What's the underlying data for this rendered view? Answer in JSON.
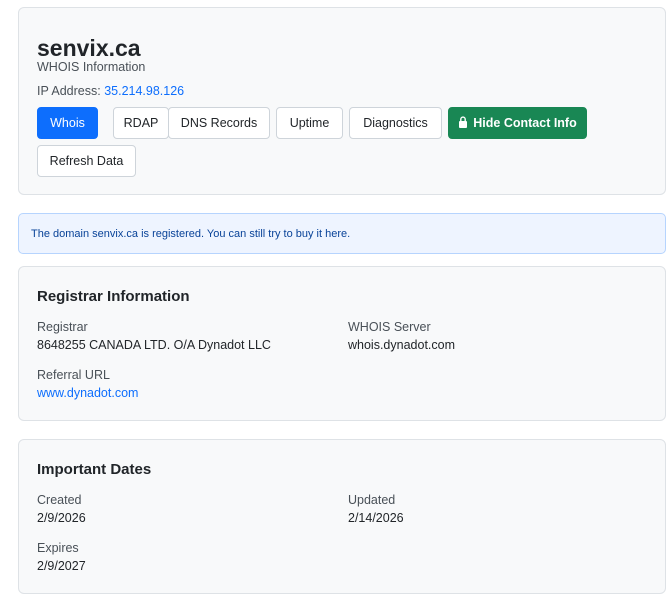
{
  "header": {
    "domain": "senvix.ca",
    "subtitle": "WHOIS Information",
    "ip_label": "IP Address:",
    "ip_value": "35.214.98.126"
  },
  "buttons": {
    "whois": "Whois",
    "rdap": "RDAP",
    "dns": "DNS Records",
    "uptime": "Uptime",
    "diagnostics": "Diagnostics",
    "hide_contact": "Hide Contact Info",
    "refresh": "Refresh Data"
  },
  "alert": {
    "prefix": "The domain",
    "domain": "senvix.ca",
    "middle": "is registered. You can still try to buy it",
    "link_text": "here",
    "suffix": "."
  },
  "registrar": {
    "title": "Registrar Information",
    "registrar_label": "Registrar",
    "registrar_value": "8648255 CANADA LTD. O/A Dynadot LLC",
    "whois_server_label": "WHOIS Server",
    "whois_server_value": "whois.dynadot.com",
    "referral_label": "Referral URL",
    "referral_value": "www.dynadot.com"
  },
  "dates": {
    "title": "Important Dates",
    "created_label": "Created",
    "created_value": "2/9/2026",
    "updated_label": "Updated",
    "updated_value": "2/14/2026",
    "expires_label": "Expires",
    "expires_value": "2/9/2027"
  },
  "icons": {
    "hide_contact": "lock-icon"
  },
  "colors": {
    "primary": "#0d6efd",
    "success": "#198754",
    "alert_bg": "#eef4ff",
    "alert_text": "#084298"
  }
}
